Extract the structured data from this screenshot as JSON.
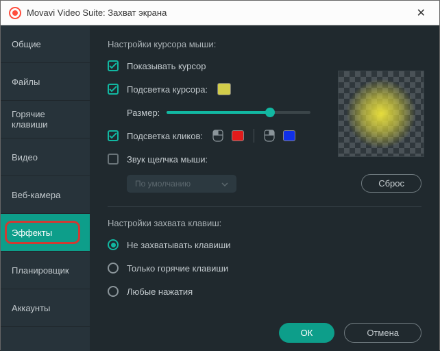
{
  "window": {
    "title": "Movavi Video Suite: Захват экрана"
  },
  "sidebar": {
    "items": [
      {
        "label": "Общие"
      },
      {
        "label": "Файлы"
      },
      {
        "label": "Горячие клавиши"
      },
      {
        "label": "Видео"
      },
      {
        "label": "Веб-камера"
      },
      {
        "label": "Эффекты"
      },
      {
        "label": "Планировщик"
      },
      {
        "label": "Аккаунты"
      }
    ],
    "active_index": 5
  },
  "cursor_section": {
    "title": "Настройки курсора мыши:",
    "show_cursor": {
      "label": "Показывать курсор",
      "checked": true
    },
    "highlight_cursor": {
      "label": "Подсветка курсора:",
      "checked": true,
      "color": "#d2cd4a"
    },
    "size": {
      "label": "Размер:",
      "value": 72
    },
    "highlight_clicks": {
      "label": "Подсветка кликов:",
      "checked": true,
      "left_color": "#e11b1b",
      "right_color": "#1030e8"
    },
    "click_sound": {
      "label": "Звук щелчка мыши:",
      "checked": false
    },
    "dropdown": {
      "label": "По умолчанию"
    },
    "reset": "Сброс"
  },
  "keys_section": {
    "title": "Настройки захвата клавиш:",
    "options": [
      {
        "label": "Не захватывать клавиши",
        "selected": true
      },
      {
        "label": "Только горячие клавиши",
        "selected": false
      },
      {
        "label": "Любые нажатия",
        "selected": false
      }
    ]
  },
  "footer": {
    "ok": "ОК",
    "cancel": "Отмена"
  }
}
